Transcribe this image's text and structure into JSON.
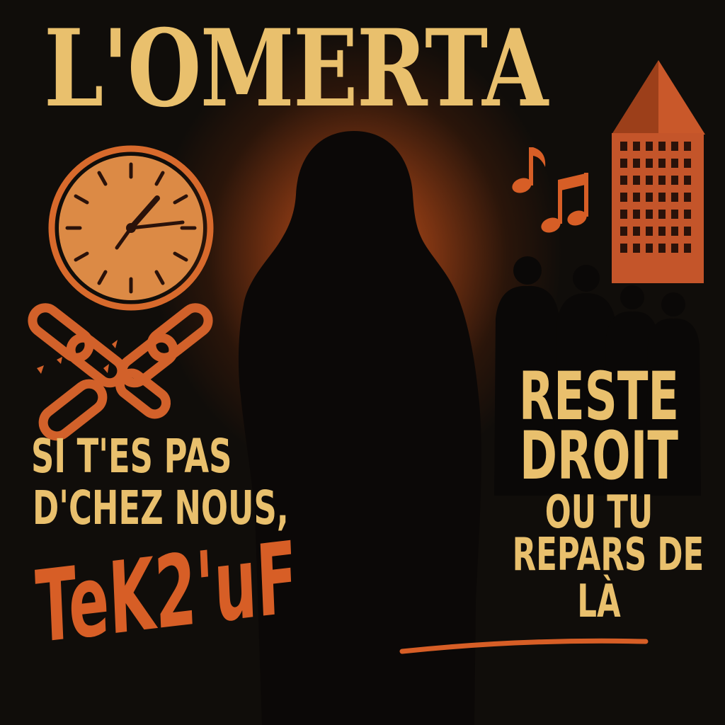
{
  "poster": {
    "title": "L'OMERTA",
    "left_text": {
      "line1": "SI T'ES PAS",
      "line2": "D'CHEZ NOUS,",
      "tag": "TeK2'uF"
    },
    "right_text": {
      "line1": "RESTE",
      "line2": "DROIT",
      "line3": "OU TU",
      "line4": "REPARS DE",
      "line5": "LÀ"
    }
  },
  "icons": [
    "clock-icon",
    "broken-chain-icon",
    "music-notes-icon",
    "tower-icon",
    "crowd-silhouettes",
    "hooded-figure"
  ],
  "colors": {
    "background": "#0f0d0a",
    "cream": "#e9c06d",
    "orange": "#d75e26",
    "glow": "#c4551c"
  }
}
